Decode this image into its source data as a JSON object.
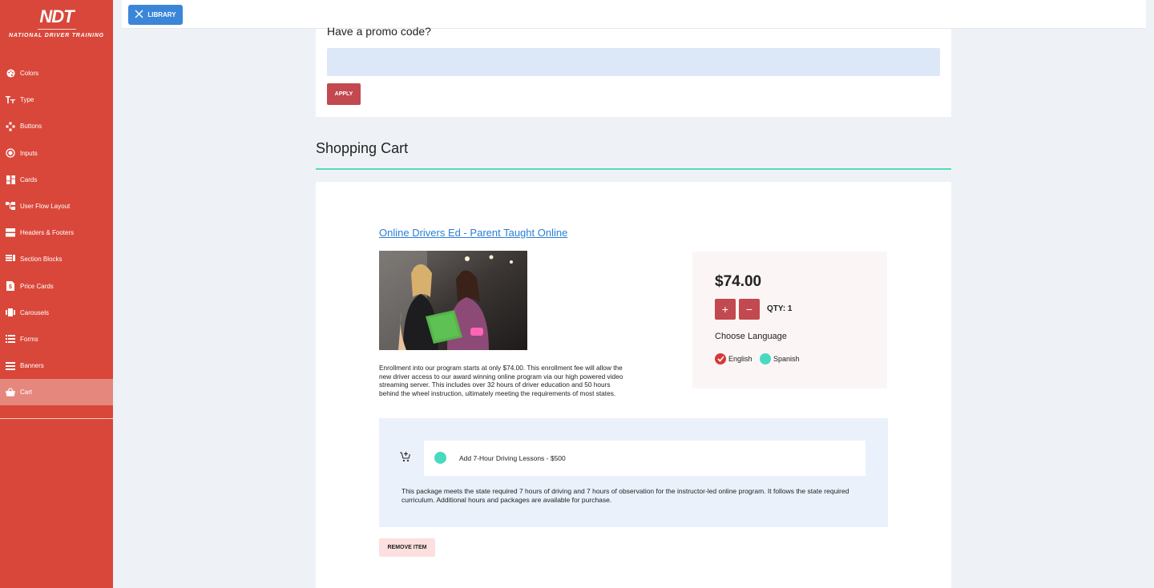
{
  "brand": {
    "logo_text": "NDT",
    "logo_subtext": "NATIONAL DRIVER TRAINING",
    "accent_color": "#d9473a"
  },
  "sidebar": {
    "items": [
      {
        "label": "Colors",
        "icon": "palette-icon"
      },
      {
        "label": "Type",
        "icon": "text-type-icon"
      },
      {
        "label": "Buttons",
        "icon": "gamepad-icon"
      },
      {
        "label": "Inputs",
        "icon": "radio-button-icon"
      },
      {
        "label": "Cards",
        "icon": "dashboard-icon"
      },
      {
        "label": "User Flow Layout",
        "icon": "flow-icon"
      },
      {
        "label": "Headers & Footers",
        "icon": "header-footer-icon"
      },
      {
        "label": "Section Blocks",
        "icon": "section-blocks-icon"
      },
      {
        "label": "Price Cards",
        "icon": "price-tag-icon"
      },
      {
        "label": "Carousels",
        "icon": "carousel-icon"
      },
      {
        "label": "Forms",
        "icon": "list-icon"
      },
      {
        "label": "Banners",
        "icon": "banner-icon"
      },
      {
        "label": "Cart",
        "icon": "basket-icon",
        "active": true
      }
    ]
  },
  "topbar": {
    "library_label": "LIBRARY"
  },
  "promo": {
    "title": "Have a promo code?",
    "input_value": "",
    "apply_label": "APPLY"
  },
  "cart": {
    "heading": "Shopping Cart",
    "product": {
      "title": "Online Drivers Ed - Parent Taught Online",
      "description": "Enrollment into our program starts at only $74.00. This enrollment fee will allow the new driver access to our award winning online program via our high powered video streaming server. This includes over 32 hours of driver education and 50 hours behind the wheel instruction, ultimately meeting the requirements of most states.",
      "price": "$74.00",
      "qty_plus": "+",
      "qty_minus": "−",
      "qty_label": "QTY: 1",
      "language_title": "Choose Language",
      "languages": [
        {
          "label": "English",
          "selected": true
        },
        {
          "label": "Spanish",
          "selected": false
        }
      ]
    },
    "addon": {
      "label": "Add 7-Hour Driving Lessons - $500",
      "description": "This package meets the state required 7 hours of driving and 7 hours of observation for the instructor-led online program. It follows the state required curriculum. Additional hours and packages are available for purchase."
    },
    "remove_label": "REMOVE ITEM"
  }
}
